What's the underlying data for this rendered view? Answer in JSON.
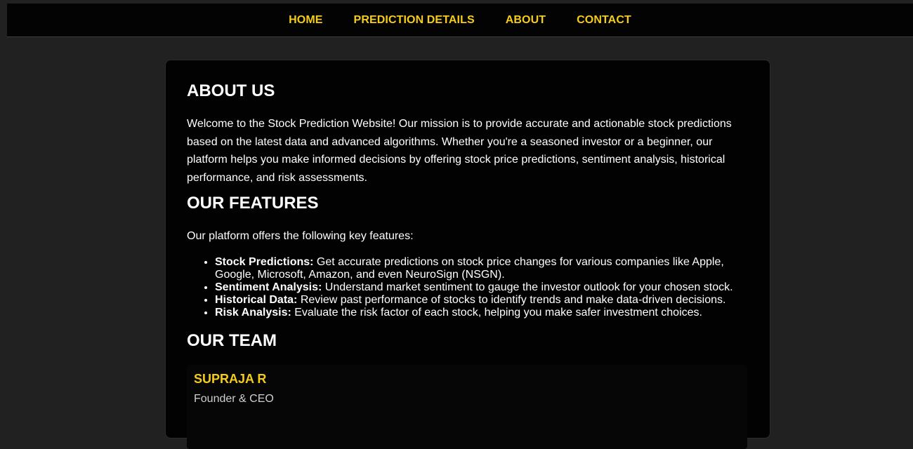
{
  "nav": {
    "items": [
      {
        "label": "HOME"
      },
      {
        "label": "PREDICTION DETAILS"
      },
      {
        "label": "ABOUT"
      },
      {
        "label": "CONTACT"
      }
    ]
  },
  "about": {
    "title": "ABOUT US",
    "text": "Welcome to the Stock Prediction Website! Our mission is to provide accurate and actionable stock predictions based on the latest data and advanced algorithms. Whether you're a seasoned investor or a beginner, our platform helps you make informed decisions by offering stock price predictions, sentiment analysis, historical performance, and risk assessments."
  },
  "features": {
    "title": "OUR FEATURES",
    "intro": "Our platform offers the following key features:",
    "items": [
      {
        "name": "Stock Predictions:",
        "desc": " Get accurate predictions on stock price changes for various companies like Apple, Google, Microsoft, Amazon, and even NeuroSign (NSGN)."
      },
      {
        "name": "Sentiment Analysis:",
        "desc": " Understand market sentiment to gauge the investor outlook for your chosen stock."
      },
      {
        "name": "Historical Data:",
        "desc": " Review past performance of stocks to identify trends and make data-driven decisions."
      },
      {
        "name": "Risk Analysis:",
        "desc": " Evaluate the risk factor of each stock, helping you make safer investment choices."
      }
    ]
  },
  "team": {
    "title": "OUR TEAM",
    "members": [
      {
        "name": "SUPRAJA R",
        "role": "Founder & CEO"
      }
    ]
  },
  "colors": {
    "accent": "#f5cc1b",
    "background": "#212121",
    "card": "#020202"
  }
}
